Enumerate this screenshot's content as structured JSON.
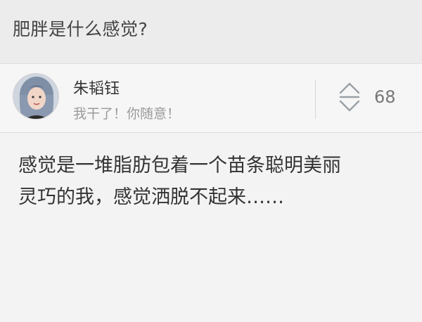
{
  "question": {
    "title": "肥胖是什么感觉?"
  },
  "answer": {
    "author": {
      "name": "朱韬钰",
      "bio": "我干了！你随意！",
      "avatar_icon": "avatar-photo"
    },
    "votes": {
      "icon": "vote-up-down-icon",
      "count": "68"
    },
    "body": "感觉是一堆脂肪包着一个苗条聪明美丽\n灵巧的我，感觉洒脱不起来……"
  }
}
